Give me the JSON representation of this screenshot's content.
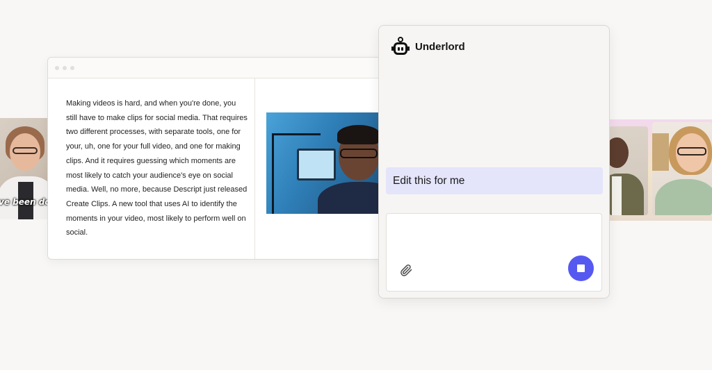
{
  "left_clip": {
    "caption": "ve been doing"
  },
  "editor": {
    "transcript": "Making videos is hard, and when you're done, you still have to make clips for social media. That requires two different processes, with separate tools, one for your, uh, one for your full video, and one for making clips. And it requires guessing which moments are most likely to catch your audience's eye on social media. Well, no more, because Descript just released Create Clips. A new tool that uses AI to identify the moments in your video, most likely to perform well on social."
  },
  "assistant": {
    "title": "Underlord",
    "icon": "robot-icon",
    "prompt_chip": "Edit this for me",
    "composer": {
      "value": "",
      "placeholder": ""
    },
    "attach_icon": "paperclip-icon",
    "stop_icon": "stop-icon",
    "accent_color": "#5659f0",
    "chip_color": "#e4e4fb"
  }
}
